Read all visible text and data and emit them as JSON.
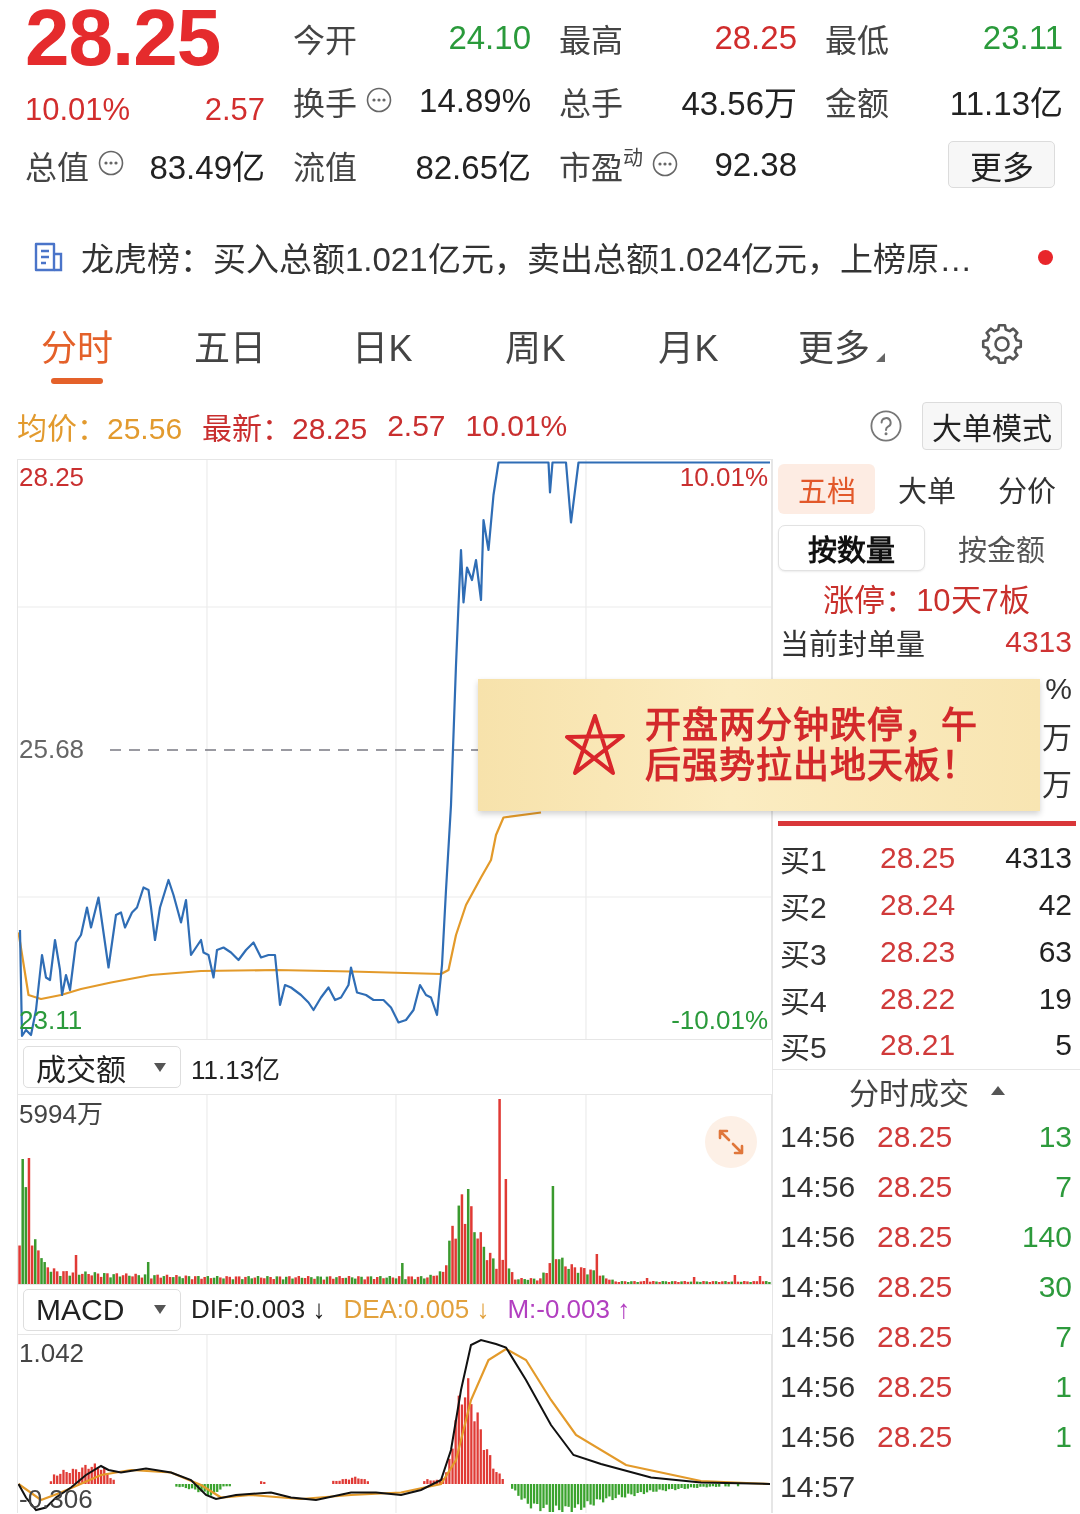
{
  "quote": {
    "price": "28.25",
    "change_percent": "10.01%",
    "change": "2.57",
    "market_cap": {
      "label": "总值",
      "value": "83.49亿",
      "info": true
    }
  },
  "stats": [
    {
      "label": "今开",
      "value": "24.10",
      "color": "#2a9a3b"
    },
    {
      "label": "最高",
      "value": "28.25",
      "color": "#d02c2c"
    },
    {
      "label": "最低",
      "value": "23.11",
      "color": "#2a9a3b"
    },
    {
      "label": "换手",
      "value": "14.89%",
      "color": "#222222",
      "info": true
    },
    {
      "label": "总手",
      "value": "43.56万",
      "color": "#222222"
    },
    {
      "label": "金额",
      "value": "11.13亿",
      "color": "#222222"
    },
    {
      "label": "流值",
      "value": "82.65亿",
      "color": "#222222"
    },
    {
      "label": "市盈$^{动}$",
      "value": "92.38",
      "color": "#222222",
      "info": true
    }
  ],
  "more_button": "更多",
  "news": {
    "text": "龙虎榜：买入总额1.021亿元，卖出总额1.024亿元，上榜原…",
    "unread": true
  },
  "tabs": [
    {
      "label": "分时",
      "selected": true,
      "kind": "period"
    },
    {
      "label": "五日",
      "selected": false,
      "kind": "period"
    },
    {
      "label": "日K",
      "selected": false,
      "kind": "period"
    },
    {
      "label": "周K",
      "selected": false,
      "kind": "period"
    },
    {
      "label": "月K",
      "selected": false,
      "kind": "period"
    },
    {
      "label": "更多",
      "selected": false,
      "kind": "menu"
    }
  ],
  "summary": {
    "items": [
      {
        "text": "均价：25.56",
        "color": "#e29a2e"
      },
      {
        "text": "最新：28.25",
        "color": "#c92f2f"
      },
      {
        "text": "2.57",
        "color": "#c92f2f"
      },
      {
        "text": "10.01%",
        "color": "#c92f2f"
      }
    ],
    "mode_button": "大单模式"
  },
  "price_chart": {
    "max_label": "28.25",
    "ref_label": "25.68",
    "min_label": "23.11",
    "max_pct": "10.01%",
    "min_pct": "-10.01%"
  },
  "volume_panel": {
    "selector": "成交额",
    "total": "11.13亿",
    "max_label": "5994万"
  },
  "macd_panel": {
    "selector": "MACD",
    "dif": "DIF:0.003 ↓",
    "dea": "DEA:0.005 ↓",
    "m": "M:-0.003 ↑",
    "max_label": "1.042",
    "min_label": "-0.306"
  },
  "order_panel": {
    "tabs": [
      {
        "label": "五档",
        "selected": true
      },
      {
        "label": "大单",
        "selected": false
      },
      {
        "label": "分价",
        "selected": false
      }
    ],
    "units": [
      {
        "label": "按数量",
        "selected": true
      },
      {
        "label": "按金额",
        "selected": false
      }
    ],
    "limit_text": "涨停：10天7板",
    "seal_rows": [
      {
        "label": "当前封单量",
        "value": "4313",
        "color": "#cf3333"
      },
      {
        "value": "%",
        "color": "#333333"
      },
      {
        "value": "万",
        "color": "#333333"
      },
      {
        "value": "万",
        "color": "#333333"
      }
    ],
    "bids": [
      {
        "label": "买1",
        "price": "28.25",
        "volume": "4313"
      },
      {
        "label": "买2",
        "price": "28.24",
        "volume": "42"
      },
      {
        "label": "买3",
        "price": "28.23",
        "volume": "63"
      },
      {
        "label": "买4",
        "price": "28.22",
        "volume": "19"
      },
      {
        "label": "买5",
        "price": "28.21",
        "volume": "5"
      }
    ],
    "trades_title": "分时成交",
    "trades": [
      {
        "time": "14:56",
        "price": "28.25",
        "volume": "13"
      },
      {
        "time": "14:56",
        "price": "28.25",
        "volume": "7"
      },
      {
        "time": "14:56",
        "price": "28.25",
        "volume": "140"
      },
      {
        "time": "14:56",
        "price": "28.25",
        "volume": "30"
      },
      {
        "time": "14:56",
        "price": "28.25",
        "volume": "7"
      },
      {
        "time": "14:56",
        "price": "28.25",
        "volume": "1"
      },
      {
        "time": "14:56",
        "price": "28.25",
        "volume": "1"
      },
      {
        "time": "14:57"
      }
    ]
  },
  "note": {
    "text": "开盘两分钟跌停，午后强势拉出地天板！"
  }
}
